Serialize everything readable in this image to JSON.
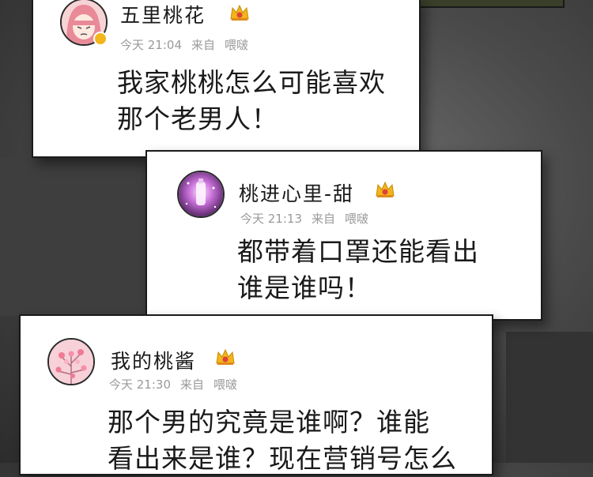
{
  "comments": [
    {
      "username": "五里桃花",
      "time": "今天 21:04",
      "source_prefix": "来自",
      "source": "喂啵",
      "lines": [
        "我家桃桃怎么可能喜欢",
        "那个老男人！"
      ],
      "avatar": "girl-avatar-icon",
      "verified": true
    },
    {
      "username": "桃进心里-甜",
      "time": "今天 21:13",
      "source_prefix": "来自",
      "source": "喂啵",
      "lines": [
        "都带着口罩还能看出",
        "谁是谁吗！"
      ],
      "avatar": "glowing-bottle-avatar-icon"
    },
    {
      "username": "我的桃酱",
      "time": "今天 21:30",
      "source_prefix": "来自",
      "source": "喂啵",
      "lines": [
        "那个男的究竟是谁啊？谁能",
        "看出来是谁？现在营销号怎么"
      ],
      "avatar": "peach-blossom-avatar-icon"
    }
  ],
  "colors": {
    "crown": "#f2b51b",
    "crown_gem": "#e0403a",
    "meta_text": "#9a9a9a",
    "badge": "#f2b51b"
  }
}
